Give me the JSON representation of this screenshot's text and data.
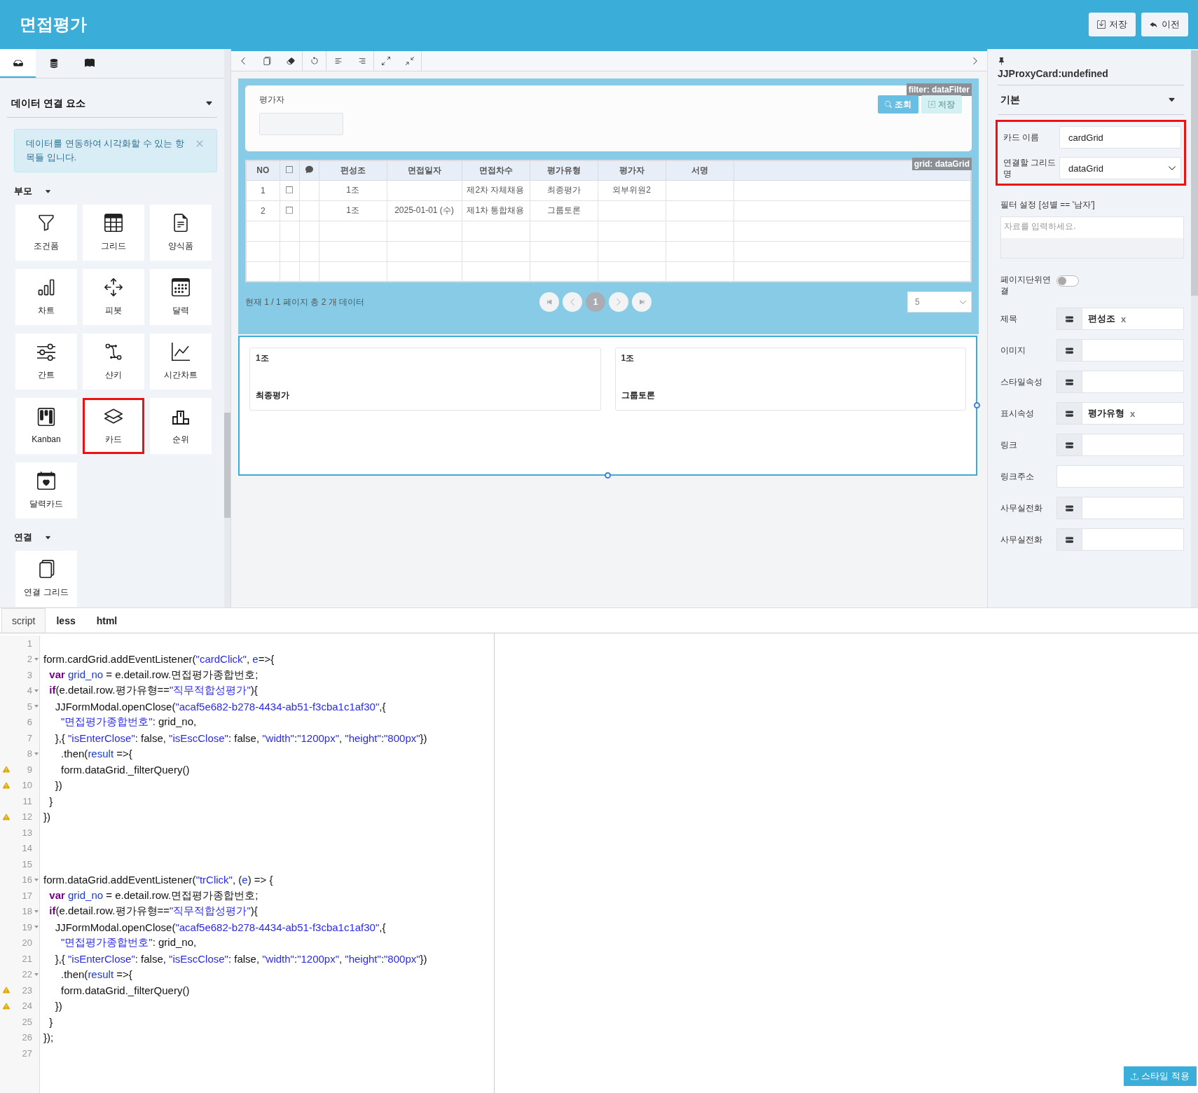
{
  "header": {
    "title": "면접평가",
    "buttons": [
      {
        "label": "저장",
        "kind": "save"
      },
      {
        "label": "이전",
        "kind": "back"
      }
    ]
  },
  "left_panel": {
    "tabs": [
      {
        "kind": "inbox",
        "selected": true
      },
      {
        "kind": "database",
        "selected": false
      },
      {
        "kind": "book",
        "selected": false
      }
    ],
    "section_title": "데이터 연결 요소",
    "notice": "데이터를 연동하여 시각화할 수 있는 항목들 입니다.",
    "groups": [
      {
        "label": "부모",
        "items": [
          {
            "label": "조건폼",
            "kind": "filter",
            "highlighted": false
          },
          {
            "label": "그리드",
            "kind": "grid",
            "highlighted": false
          },
          {
            "label": "양식폼",
            "kind": "form",
            "highlighted": false
          },
          {
            "label": "차트",
            "kind": "chart",
            "highlighted": false
          },
          {
            "label": "피봇",
            "kind": "pivot",
            "highlighted": false
          },
          {
            "label": "달력",
            "kind": "calendar",
            "highlighted": false
          },
          {
            "label": "간트",
            "kind": "gantt",
            "highlighted": false
          },
          {
            "label": "샨키",
            "kind": "sankey",
            "highlighted": false
          },
          {
            "label": "시간차트",
            "kind": "timechart",
            "highlighted": false
          },
          {
            "label": "Kanban",
            "kind": "kanban",
            "highlighted": false
          },
          {
            "label": "카드",
            "kind": "card",
            "highlighted": true
          },
          {
            "label": "순위",
            "kind": "rank",
            "highlighted": false
          },
          {
            "label": "달력카드",
            "kind": "calendarcard",
            "highlighted": false
          }
        ]
      },
      {
        "label": "연결",
        "items": [
          {
            "label": "연결 그리드",
            "kind": "linked",
            "highlighted": false
          }
        ]
      }
    ]
  },
  "center": {
    "toolbar": [
      {
        "kind": "prev"
      },
      {
        "kind": "copy"
      },
      {
        "kind": "erase"
      },
      {
        "kind": "undo"
      },
      {
        "kind": "align-left"
      },
      {
        "kind": "align-right"
      },
      {
        "kind": "expand"
      },
      {
        "kind": "collapse"
      }
    ],
    "filter": {
      "tag": "filter: dataFilter",
      "field_label": "평가자",
      "buttons": [
        {
          "label": "조회",
          "kind": "search",
          "disabled": false
        },
        {
          "label": "저장",
          "kind": "save",
          "disabled": true
        }
      ]
    },
    "grid": {
      "tag": "grid: dataGrid",
      "columns": [
        {
          "kind": "text",
          "label": "NO"
        },
        {
          "kind": "checkbox"
        },
        {
          "kind": "comment"
        },
        {
          "kind": "text",
          "label": "편성조"
        },
        {
          "kind": "text",
          "label": "면접일자"
        },
        {
          "kind": "text",
          "label": "면접차수"
        },
        {
          "kind": "text",
          "label": "평가유형"
        },
        {
          "kind": "text",
          "label": "평가자"
        },
        {
          "kind": "text",
          "label": "서명"
        }
      ],
      "rows": [
        {
          "checked": false,
          "cells": {
            "0": "1",
            "3": "1조",
            "5": "제2차 자체채용",
            "6": "최종평가",
            "7": "외부위원2"
          }
        },
        {
          "checked": false,
          "cells": {
            "0": "2",
            "3": "1조",
            "4": "2025-01-01 (수)",
            "5": "제1차 통합채용",
            "6": "그룹토론"
          }
        }
      ]
    },
    "pagination": {
      "status": "현재 1 / 1 페이지 총 2 개 데이터",
      "pages": [
        {
          "label": "1",
          "selected": true
        }
      ],
      "page_size": "5"
    },
    "cards": [
      {
        "title": "1조",
        "text": "최종평가"
      },
      {
        "title": "1조",
        "text": "그룹토론"
      }
    ]
  },
  "right_panel": {
    "title": "JJProxyCard:undefined",
    "section": "기본",
    "main_fields": {
      "highlighted": true,
      "items": [
        {
          "label": "카드 이름",
          "kind": "text",
          "value": "cardGrid"
        },
        {
          "label": "연결할 그리드명",
          "kind": "select",
          "value": "dataGrid"
        }
      ]
    },
    "filter_label": "필터 설정 [성별 == '남자']",
    "filter_placeholder": "자료를 입력하세요.",
    "toggle": {
      "label": "페이지단위연결",
      "on": false
    },
    "bindings": [
      {
        "label": "제목",
        "kind": "binding",
        "tag": {
          "label": "편성조",
          "remove": "x"
        }
      },
      {
        "label": "이미지",
        "kind": "binding"
      },
      {
        "label": "스타일속성",
        "kind": "binding"
      },
      {
        "label": "표시속성",
        "kind": "binding",
        "tag": {
          "label": "평가유형",
          "remove": "x"
        }
      },
      {
        "label": "링크",
        "kind": "binding"
      },
      {
        "label": "링크주소",
        "kind": "text"
      },
      {
        "label": "사무실전화",
        "kind": "binding"
      },
      {
        "label": "사무실전화",
        "kind": "binding"
      }
    ]
  },
  "editor": {
    "tabs": [
      {
        "label": "script",
        "selected": true
      },
      {
        "label": "less",
        "selected": false
      },
      {
        "label": "html",
        "selected": false
      }
    ],
    "lines": [
      {
        "no": "1",
        "fold": false,
        "warning": false
      },
      {
        "no": "2",
        "fold": true,
        "warning": false,
        "tokens": [
          {
            "text": "form.cardGrid.addEventListener(",
            "kind": "plain"
          },
          {
            "text": "\"cardClick\"",
            "kind": "string"
          },
          {
            "text": ", ",
            "kind": "plain"
          },
          {
            "text": "e",
            "kind": "variable"
          },
          {
            "text": "=>{",
            "kind": "plain"
          }
        ]
      },
      {
        "no": "3",
        "fold": false,
        "warning": false,
        "tokens": [
          {
            "text": "  var",
            "kind": "keyword"
          },
          {
            "text": " grid_no",
            "kind": "variable"
          },
          {
            "text": " = e.detail.row.면접평가종합번호;",
            "kind": "plain"
          }
        ]
      },
      {
        "no": "4",
        "fold": true,
        "warning": false,
        "tokens": [
          {
            "text": "  if",
            "kind": "keyword"
          },
          {
            "text": "(e.detail.row.평가유형==",
            "kind": "plain"
          },
          {
            "text": "\"직무적합성평가\"",
            "kind": "string"
          },
          {
            "text": "){",
            "kind": "plain"
          }
        ]
      },
      {
        "no": "5",
        "fold": true,
        "warning": false,
        "tokens": [
          {
            "text": "    JJFormModal.openClose(",
            "kind": "plain"
          },
          {
            "text": "\"acaf5e682-b278-4434-ab51-f3cba1c1af30\"",
            "kind": "string"
          },
          {
            "text": ",{",
            "kind": "plain"
          }
        ]
      },
      {
        "no": "6",
        "fold": false,
        "warning": false,
        "tokens": [
          {
            "text": "      \"면접평가종합번호\"",
            "kind": "string"
          },
          {
            "text": ": grid_no,",
            "kind": "plain"
          }
        ]
      },
      {
        "no": "7",
        "fold": false,
        "warning": false,
        "tokens": [
          {
            "text": "    },{ ",
            "kind": "plain"
          },
          {
            "text": "\"isEnterClose\"",
            "kind": "string"
          },
          {
            "text": ": false, ",
            "kind": "plain"
          },
          {
            "text": "\"isEscClose\"",
            "kind": "string"
          },
          {
            "text": ": false, ",
            "kind": "plain"
          },
          {
            "text": "\"width\"",
            "kind": "string"
          },
          {
            "text": ":",
            "kind": "plain"
          },
          {
            "text": "\"1200px\"",
            "kind": "string"
          },
          {
            "text": ", ",
            "kind": "plain"
          },
          {
            "text": "\"height\"",
            "kind": "string"
          },
          {
            "text": ":",
            "kind": "plain"
          },
          {
            "text": "\"800px\"",
            "kind": "string"
          },
          {
            "text": "})",
            "kind": "plain"
          }
        ]
      },
      {
        "no": "8",
        "fold": true,
        "warning": false,
        "tokens": [
          {
            "text": "      .then(",
            "kind": "plain"
          },
          {
            "text": "result",
            "kind": "variable"
          },
          {
            "text": " =>{",
            "kind": "plain"
          }
        ]
      },
      {
        "no": "9",
        "fold": false,
        "warning": true,
        "tokens": [
          {
            "text": "      form.dataGrid._filterQuery()",
            "kind": "plain"
          }
        ]
      },
      {
        "no": "10",
        "fold": false,
        "warning": true,
        "tokens": [
          {
            "text": "    })",
            "kind": "plain"
          }
        ]
      },
      {
        "no": "11",
        "fold": false,
        "warning": false,
        "tokens": [
          {
            "text": "  }",
            "kind": "plain"
          }
        ]
      },
      {
        "no": "12",
        "fold": false,
        "warning": true,
        "tokens": [
          {
            "text": "})",
            "kind": "plain"
          }
        ]
      },
      {
        "no": "13",
        "fold": false,
        "warning": false
      },
      {
        "no": "14",
        "fold": false,
        "warning": false
      },
      {
        "no": "15",
        "fold": false,
        "warning": false
      },
      {
        "no": "16",
        "fold": true,
        "warning": false,
        "tokens": [
          {
            "text": "form.dataGrid.addEventListener(",
            "kind": "plain"
          },
          {
            "text": "\"trClick\"",
            "kind": "string"
          },
          {
            "text": ", (",
            "kind": "plain"
          },
          {
            "text": "e",
            "kind": "variable"
          },
          {
            "text": ") => {",
            "kind": "plain"
          }
        ]
      },
      {
        "no": "17",
        "fold": false,
        "warning": false,
        "tokens": [
          {
            "text": "  var",
            "kind": "keyword"
          },
          {
            "text": " grid_no",
            "kind": "variable"
          },
          {
            "text": " = e.detail.row.면접평가종합번호;",
            "kind": "plain"
          }
        ]
      },
      {
        "no": "18",
        "fold": true,
        "warning": false,
        "tokens": [
          {
            "text": "  if",
            "kind": "keyword"
          },
          {
            "text": "(e.detail.row.평가유형==",
            "kind": "plain"
          },
          {
            "text": "\"직무적합성평가\"",
            "kind": "string"
          },
          {
            "text": "){",
            "kind": "plain"
          }
        ]
      },
      {
        "no": "19",
        "fold": true,
        "warning": false,
        "tokens": [
          {
            "text": "    JJFormModal.openClose(",
            "kind": "plain"
          },
          {
            "text": "\"acaf5e682-b278-4434-ab51-f3cba1c1af30\"",
            "kind": "string"
          },
          {
            "text": ",{",
            "kind": "plain"
          }
        ]
      },
      {
        "no": "20",
        "fold": false,
        "warning": false,
        "tokens": [
          {
            "text": "      \"면접평가종합번호\"",
            "kind": "string"
          },
          {
            "text": ": grid_no,",
            "kind": "plain"
          }
        ]
      },
      {
        "no": "21",
        "fold": false,
        "warning": false,
        "tokens": [
          {
            "text": "    },{ ",
            "kind": "plain"
          },
          {
            "text": "\"isEnterClose\"",
            "kind": "string"
          },
          {
            "text": ": false, ",
            "kind": "plain"
          },
          {
            "text": "\"isEscClose\"",
            "kind": "string"
          },
          {
            "text": ": false, ",
            "kind": "plain"
          },
          {
            "text": "\"width\"",
            "kind": "string"
          },
          {
            "text": ":",
            "kind": "plain"
          },
          {
            "text": "\"1200px\"",
            "kind": "string"
          },
          {
            "text": ", ",
            "kind": "plain"
          },
          {
            "text": "\"height\"",
            "kind": "string"
          },
          {
            "text": ":",
            "kind": "plain"
          },
          {
            "text": "\"800px\"",
            "kind": "string"
          },
          {
            "text": "})",
            "kind": "plain"
          }
        ]
      },
      {
        "no": "22",
        "fold": true,
        "warning": false,
        "tokens": [
          {
            "text": "      .then(",
            "kind": "plain"
          },
          {
            "text": "result",
            "kind": "variable"
          },
          {
            "text": " =>{",
            "kind": "plain"
          }
        ]
      },
      {
        "no": "23",
        "fold": false,
        "warning": true,
        "tokens": [
          {
            "text": "      form.dataGrid._filterQuery()",
            "kind": "plain"
          }
        ]
      },
      {
        "no": "24",
        "fold": false,
        "warning": true,
        "tokens": [
          {
            "text": "    })",
            "kind": "plain"
          }
        ]
      },
      {
        "no": "25",
        "fold": false,
        "warning": false,
        "tokens": [
          {
            "text": "  }",
            "kind": "plain"
          }
        ]
      },
      {
        "no": "26",
        "fold": false,
        "warning": false,
        "tokens": [
          {
            "text": "});",
            "kind": "plain"
          }
        ]
      },
      {
        "no": "27",
        "fold": false,
        "warning": false
      }
    ],
    "apply_button": "스타일 적용"
  }
}
